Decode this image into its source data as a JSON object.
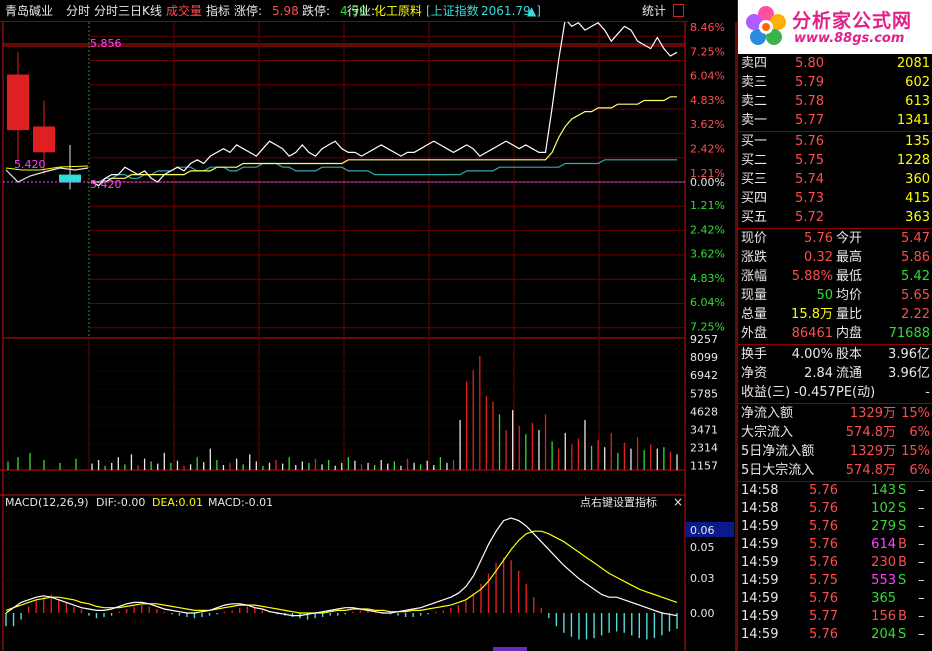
{
  "toolbar": {
    "stock_name": "青岛碱业",
    "tab_timeshare": "分时",
    "tab_3day": "分时三日",
    "tab_kline": "K线",
    "btn_volume": "成交量",
    "btn_indicator": "指标",
    "limit_up_label": "涨停:",
    "limit_up_value": "5.98",
    "limit_down_label": "跌停:",
    "limit_down_value": "4.90",
    "industry_label": "行业:",
    "industry_value": "化工原料",
    "index_label": "[上证指数",
    "index_value": "2061.79",
    "index_arrow": "▲]",
    "stats_button": "统计",
    "menu_icon": "window-menu-icon"
  },
  "price_axis": {
    "upper_pct": [
      "8.46%",
      "7.25%",
      "6.04%",
      "4.83%",
      "3.62%",
      "2.42%",
      "1.21%"
    ],
    "zero_pct": "0.00%",
    "lower_pct": [
      "1.21%",
      "2.42%",
      "3.62%",
      "4.83%",
      "6.04%",
      "7.25%"
    ]
  },
  "price_labels": {
    "high_mark": "5.856",
    "prev_close_mark": "5.420",
    "left_mark": "5.420"
  },
  "volume_axis": [
    "9257",
    "8099",
    "6942",
    "5785",
    "4628",
    "3471",
    "2314",
    "1157"
  ],
  "macd": {
    "title": "MACD(12,26,9)",
    "dif": "DIF:-0.00",
    "dea": "DEA:0.01",
    "macd": "MACD:-0.01",
    "hint": "点右键设置指标",
    "close_icon": "×",
    "current_value": "0.06",
    "axis": [
      "0.05",
      "0.03",
      "0.00"
    ]
  },
  "logo": {
    "title": "分析家公式网",
    "url": "www.88gs.com"
  },
  "order_book": {
    "asks": [
      {
        "label": "卖四",
        "price": "5.80",
        "vol": "2081"
      },
      {
        "label": "卖三",
        "price": "5.79",
        "vol": "602"
      },
      {
        "label": "卖二",
        "price": "5.78",
        "vol": "613"
      },
      {
        "label": "卖一",
        "price": "5.77",
        "vol": "1341"
      }
    ],
    "bids": [
      {
        "label": "买一",
        "price": "5.76",
        "vol": "135"
      },
      {
        "label": "买二",
        "price": "5.75",
        "vol": "1228"
      },
      {
        "label": "买三",
        "price": "5.74",
        "vol": "360"
      },
      {
        "label": "买四",
        "price": "5.73",
        "vol": "415"
      },
      {
        "label": "买五",
        "price": "5.72",
        "vol": "363"
      }
    ]
  },
  "quote": [
    {
      "l1": "现价",
      "v1": "5.76",
      "c1": "red",
      "l2": "今开",
      "v2": "5.47",
      "c2": "red"
    },
    {
      "l1": "涨跌",
      "v1": "0.32",
      "c1": "red",
      "l2": "最高",
      "v2": "5.86",
      "c2": "red"
    },
    {
      "l1": "涨幅",
      "v1": "5.88%",
      "c1": "red",
      "l2": "最低",
      "v2": "5.42",
      "c2": "green"
    },
    {
      "l1": "现量",
      "v1": "50",
      "c1": "green",
      "l2": "均价",
      "v2": "5.65",
      "c2": "red"
    },
    {
      "l1": "总量",
      "v1": "15.8万",
      "c1": "yellow",
      "l2": "量比",
      "v2": "2.22",
      "c2": "red"
    },
    {
      "l1": "外盘",
      "v1": "86461",
      "c1": "red",
      "l2": "内盘",
      "v2": "71688",
      "c2": "green"
    }
  ],
  "fundamentals": [
    {
      "l1": "换手",
      "v1": "4.00%",
      "l2": "股本",
      "v2": "3.96亿"
    },
    {
      "l1": "净资",
      "v1": "2.84",
      "l2": "流通",
      "v2": "3.96亿"
    }
  ],
  "earnings": {
    "label": "收益(三)",
    "value": "-0.457",
    "pe_label": "PE(动)",
    "pe_value": "-"
  },
  "capital_flow": [
    {
      "label": "净流入额",
      "value": "1329万",
      "pct": "15%"
    },
    {
      "label": "大宗流入",
      "value": "574.8万",
      "pct": "6%"
    },
    {
      "label": "5日净流入额",
      "value": "1329万",
      "pct": "15%"
    },
    {
      "label": "5日大宗流入",
      "value": "574.8万",
      "pct": "6%"
    }
  ],
  "ticks": [
    {
      "time": "14:58",
      "price": "5.76",
      "vol": "143",
      "vc": "green",
      "side": "S",
      "sc": "green"
    },
    {
      "time": "14:58",
      "price": "5.76",
      "vol": "102",
      "vc": "green",
      "side": "S",
      "sc": "green"
    },
    {
      "time": "14:59",
      "price": "5.76",
      "vol": "279",
      "vc": "green",
      "side": "S",
      "sc": "green"
    },
    {
      "time": "14:59",
      "price": "5.76",
      "vol": "614",
      "vc": "magenta",
      "side": "B",
      "sc": "red"
    },
    {
      "time": "14:59",
      "price": "5.76",
      "vol": "230",
      "vc": "red",
      "side": "B",
      "sc": "red"
    },
    {
      "time": "14:59",
      "price": "5.75",
      "vol": "553",
      "vc": "magenta",
      "side": "S",
      "sc": "green"
    },
    {
      "time": "14:59",
      "price": "5.76",
      "vol": "365",
      "vc": "green",
      "side": "",
      "sc": "white"
    },
    {
      "time": "14:59",
      "price": "5.77",
      "vol": "156",
      "vc": "red",
      "side": "B",
      "sc": "red"
    },
    {
      "time": "14:59",
      "price": "5.76",
      "vol": "204",
      "vc": "green",
      "side": "S",
      "sc": "green"
    }
  ],
  "tick_dash": "–",
  "chart_data": {
    "type": "line",
    "prev_close": 5.42,
    "price_series": [
      5.42,
      5.41,
      5.43,
      5.44,
      5.44,
      5.46,
      5.45,
      5.44,
      5.45,
      5.43,
      5.42,
      5.44,
      5.45,
      5.46,
      5.45,
      5.47,
      5.48,
      5.47,
      5.49,
      5.5,
      5.51,
      5.5,
      5.52,
      5.51,
      5.5,
      5.49,
      5.51,
      5.53,
      5.52,
      5.51,
      5.49,
      5.5,
      5.52,
      5.5,
      5.49,
      5.51,
      5.52,
      5.53,
      5.51,
      5.5,
      5.5,
      5.49,
      5.5,
      5.51,
      5.52,
      5.51,
      5.5,
      5.49,
      5.5,
      5.5,
      5.51,
      5.52,
      5.53,
      5.52,
      5.51,
      5.5,
      5.51,
      5.52,
      5.51,
      5.49,
      5.5,
      5.51,
      5.52,
      5.53,
      5.52,
      5.51,
      5.52,
      5.51,
      5.5,
      5.5,
      5.62,
      5.75,
      5.86,
      5.84,
      5.85,
      5.83,
      5.84,
      5.85,
      5.83,
      5.8,
      5.82,
      5.84,
      5.83,
      5.8,
      5.79,
      5.78,
      5.81,
      5.78,
      5.76,
      5.77
    ],
    "avg_series": [
      5.42,
      5.42,
      5.42,
      5.43,
      5.43,
      5.43,
      5.44,
      5.44,
      5.44,
      5.44,
      5.44,
      5.44,
      5.44,
      5.44,
      5.44,
      5.45,
      5.45,
      5.45,
      5.45,
      5.46,
      5.46,
      5.46,
      5.46,
      5.47,
      5.47,
      5.47,
      5.47,
      5.47,
      5.47,
      5.47,
      5.47,
      5.47,
      5.47,
      5.47,
      5.47,
      5.47,
      5.47,
      5.47,
      5.47,
      5.48,
      5.48,
      5.48,
      5.48,
      5.48,
      5.48,
      5.48,
      5.48,
      5.48,
      5.48,
      5.48,
      5.48,
      5.48,
      5.48,
      5.48,
      5.48,
      5.48,
      5.48,
      5.48,
      5.48,
      5.48,
      5.48,
      5.48,
      5.48,
      5.48,
      5.48,
      5.48,
      5.48,
      5.48,
      5.48,
      5.48,
      5.5,
      5.54,
      5.57,
      5.59,
      5.6,
      5.61,
      5.61,
      5.62,
      5.62,
      5.62,
      5.63,
      5.63,
      5.63,
      5.63,
      5.64,
      5.64,
      5.64,
      5.64,
      5.65,
      5.65
    ],
    "index_series": [
      5.42,
      5.42,
      5.43,
      5.43,
      5.44,
      5.44,
      5.43,
      5.43,
      5.44,
      5.44,
      5.45,
      5.45,
      5.45,
      5.46,
      5.46,
      5.46,
      5.45,
      5.45,
      5.46,
      5.46,
      5.46,
      5.45,
      5.45,
      5.46,
      5.46,
      5.46,
      5.47,
      5.47,
      5.47,
      5.46,
      5.46,
      5.45,
      5.45,
      5.45,
      5.45,
      5.46,
      5.46,
      5.46,
      5.46,
      5.45,
      5.45,
      5.45,
      5.45,
      5.44,
      5.44,
      5.44,
      5.44,
      5.44,
      5.44,
      5.44,
      5.44,
      5.44,
      5.44,
      5.44,
      5.44,
      5.44,
      5.44,
      5.45,
      5.45,
      5.45,
      5.45,
      5.45,
      5.46,
      5.46,
      5.46,
      5.46,
      5.46,
      5.46,
      5.46,
      5.46,
      5.46,
      5.46,
      5.47,
      5.47,
      5.47,
      5.47,
      5.47,
      5.47,
      5.48,
      5.48,
      5.48,
      5.48,
      5.48,
      5.48,
      5.48,
      5.48,
      5.48,
      5.48,
      5.48,
      5.48
    ],
    "prior_days": [
      {
        "open": 5.56,
        "close": 5.71,
        "high": 5.77,
        "low": 5.48,
        "dir": "up"
      },
      {
        "open": 5.5,
        "close": 5.57,
        "high": 5.64,
        "low": 5.44,
        "dir": "up"
      },
      {
        "open": 5.43,
        "close": 5.44,
        "high": 5.52,
        "low": 5.4,
        "dir": "flat"
      }
    ],
    "volume_series": [
      450,
      700,
      300,
      500,
      900,
      400,
      1100,
      350,
      800,
      600,
      450,
      1200,
      500,
      650,
      300,
      400,
      900,
      550,
      1500,
      700,
      350,
      500,
      800,
      400,
      1100,
      600,
      300,
      500,
      700,
      450,
      900,
      350,
      600,
      500,
      800,
      400,
      700,
      300,
      500,
      900,
      650,
      400,
      500,
      350,
      700,
      450,
      600,
      300,
      800,
      500,
      400,
      650,
      350,
      900,
      500,
      700,
      3500,
      6200,
      7000,
      8000,
      5200,
      4800,
      3900,
      2800,
      4200,
      3100,
      2500,
      3300,
      2800,
      3900,
      2000,
      1500,
      2600,
      1800,
      2200,
      3500,
      1700,
      2100,
      1600,
      2600,
      1200,
      1900,
      1500,
      2300,
      1400,
      1800,
      1500,
      1600,
      1300,
      1100
    ],
    "volume_colors": [
      "w",
      "w",
      "g",
      "w",
      "w",
      "g",
      "w",
      "r",
      "w",
      "g",
      "w",
      "w",
      "g",
      "w",
      "r",
      "w",
      "g",
      "w",
      "w",
      "g",
      "w",
      "r",
      "w",
      "g",
      "w",
      "w",
      "g",
      "w",
      "r",
      "w",
      "g",
      "w",
      "w",
      "g",
      "r",
      "w",
      "g",
      "w",
      "w",
      "g",
      "w",
      "r",
      "w",
      "g",
      "w",
      "w",
      "g",
      "w",
      "r",
      "w",
      "g",
      "w",
      "w",
      "g",
      "w",
      "r",
      "w",
      "r",
      "r",
      "r",
      "r",
      "r",
      "g",
      "r",
      "w",
      "r",
      "g",
      "r",
      "w",
      "r",
      "g",
      "r",
      "w",
      "r",
      "r",
      "w",
      "g",
      "r",
      "w",
      "r",
      "g",
      "r",
      "w",
      "r",
      "g",
      "r",
      "w",
      "g",
      "r",
      "w"
    ],
    "macd_hist": [
      -0.01,
      -0.01,
      -0.005,
      0.005,
      0.01,
      0.012,
      0.014,
      0.01,
      0.008,
      0.005,
      0.003,
      -0.002,
      -0.004,
      -0.003,
      -0.002,
      0.001,
      0.003,
      0.005,
      0.006,
      0.005,
      0.003,
      0.001,
      -0.001,
      -0.002,
      -0.003,
      -0.004,
      -0.003,
      -0.002,
      -0.001,
      0.001,
      0.002,
      0.004,
      0.005,
      0.004,
      0.002,
      0.001,
      -0.001,
      -0.002,
      -0.003,
      -0.004,
      -0.005,
      -0.004,
      -0.003,
      -0.002,
      -0.002,
      -0.001,
      0.001,
      0.002,
      0.003,
      0.002,
      0.001,
      -0.001,
      -0.002,
      -0.003,
      -0.003,
      -0.002,
      -0.001,
      0.001,
      0.002,
      0.004,
      0.006,
      0.009,
      0.014,
      0.022,
      0.03,
      0.038,
      0.042,
      0.04,
      0.032,
      0.022,
      0.012,
      0.004,
      -0.004,
      -0.01,
      -0.015,
      -0.018,
      -0.02,
      -0.02,
      -0.019,
      -0.017,
      -0.015,
      -0.014,
      -0.015,
      -0.017,
      -0.019,
      -0.02,
      -0.019,
      -0.017,
      -0.014,
      -0.012
    ],
    "macd_dif": [
      0.0,
      0.004,
      0.008,
      0.01,
      0.012,
      0.013,
      0.012,
      0.01,
      0.008,
      0.006,
      0.004,
      0.003,
      0.002,
      0.002,
      0.003,
      0.005,
      0.007,
      0.008,
      0.008,
      0.007,
      0.005,
      0.003,
      0.002,
      0.001,
      0.0,
      0.0,
      0.001,
      0.002,
      0.004,
      0.006,
      0.007,
      0.007,
      0.006,
      0.004,
      0.003,
      0.001,
      0.0,
      -0.001,
      -0.002,
      -0.002,
      -0.001,
      0.0,
      0.001,
      0.002,
      0.003,
      0.004,
      0.004,
      0.003,
      0.002,
      0.001,
      0.0,
      0.0,
      0.001,
      0.002,
      0.003,
      0.004,
      0.006,
      0.008,
      0.01,
      0.012,
      0.015,
      0.02,
      0.028,
      0.04,
      0.052,
      0.062,
      0.07,
      0.072,
      0.07,
      0.066,
      0.06,
      0.054,
      0.048,
      0.042,
      0.036,
      0.031,
      0.026,
      0.022,
      0.018,
      0.014,
      0.012,
      0.012,
      0.01,
      0.008,
      0.006,
      0.004,
      0.002,
      0.0,
      -0.001,
      -0.002
    ],
    "macd_dea": [
      0.002,
      0.004,
      0.006,
      0.008,
      0.01,
      0.011,
      0.012,
      0.012,
      0.011,
      0.01,
      0.008,
      0.007,
      0.005,
      0.004,
      0.004,
      0.004,
      0.005,
      0.006,
      0.007,
      0.007,
      0.007,
      0.006,
      0.005,
      0.004,
      0.003,
      0.002,
      0.002,
      0.002,
      0.003,
      0.004,
      0.005,
      0.006,
      0.006,
      0.006,
      0.005,
      0.004,
      0.003,
      0.002,
      0.001,
      0.0,
      0.0,
      0.0,
      0.0,
      0.001,
      0.002,
      0.002,
      0.003,
      0.003,
      0.003,
      0.002,
      0.002,
      0.001,
      0.001,
      0.001,
      0.002,
      0.002,
      0.003,
      0.004,
      0.005,
      0.006,
      0.008,
      0.01,
      0.014,
      0.018,
      0.024,
      0.032,
      0.04,
      0.048,
      0.055,
      0.06,
      0.062,
      0.062,
      0.06,
      0.057,
      0.054,
      0.05,
      0.046,
      0.042,
      0.038,
      0.034,
      0.03,
      0.027,
      0.024,
      0.021,
      0.018,
      0.016,
      0.014,
      0.012,
      0.01,
      0.008
    ]
  }
}
